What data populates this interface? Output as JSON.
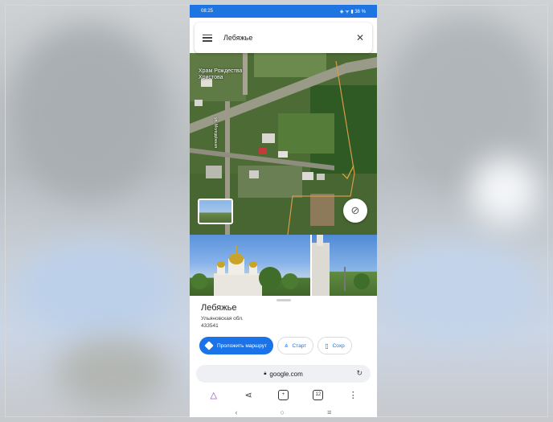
{
  "status_bar": {
    "time": "08:25",
    "battery": "36 %"
  },
  "search": {
    "query": "Лебяжье"
  },
  "map": {
    "poi_label_line1": "Храм Рождества",
    "poi_label_line2": "Христова",
    "street_label": "ул. Молодёжная"
  },
  "place": {
    "name": "Лебяжье",
    "region": "Ульяновская обл.",
    "postal_code": "433541"
  },
  "actions": {
    "route_label": "Проложить маршрут",
    "start_label": "Старт",
    "save_label": "Сохр"
  },
  "browser": {
    "url": "google.com",
    "tab_count": "12"
  },
  "colors": {
    "accent": "#1a73e8",
    "status_bar": "#1e74e0"
  },
  "icons": [
    "menu-icon",
    "close-icon",
    "layers-thumbnail",
    "locate-icon",
    "route-icon",
    "start-icon",
    "bookmark-icon",
    "lock-icon",
    "reload-icon",
    "home-icon",
    "share-icon",
    "new-tab-icon",
    "tabs-icon",
    "more-icon",
    "back-icon",
    "home-circle-icon",
    "recents-icon"
  ]
}
